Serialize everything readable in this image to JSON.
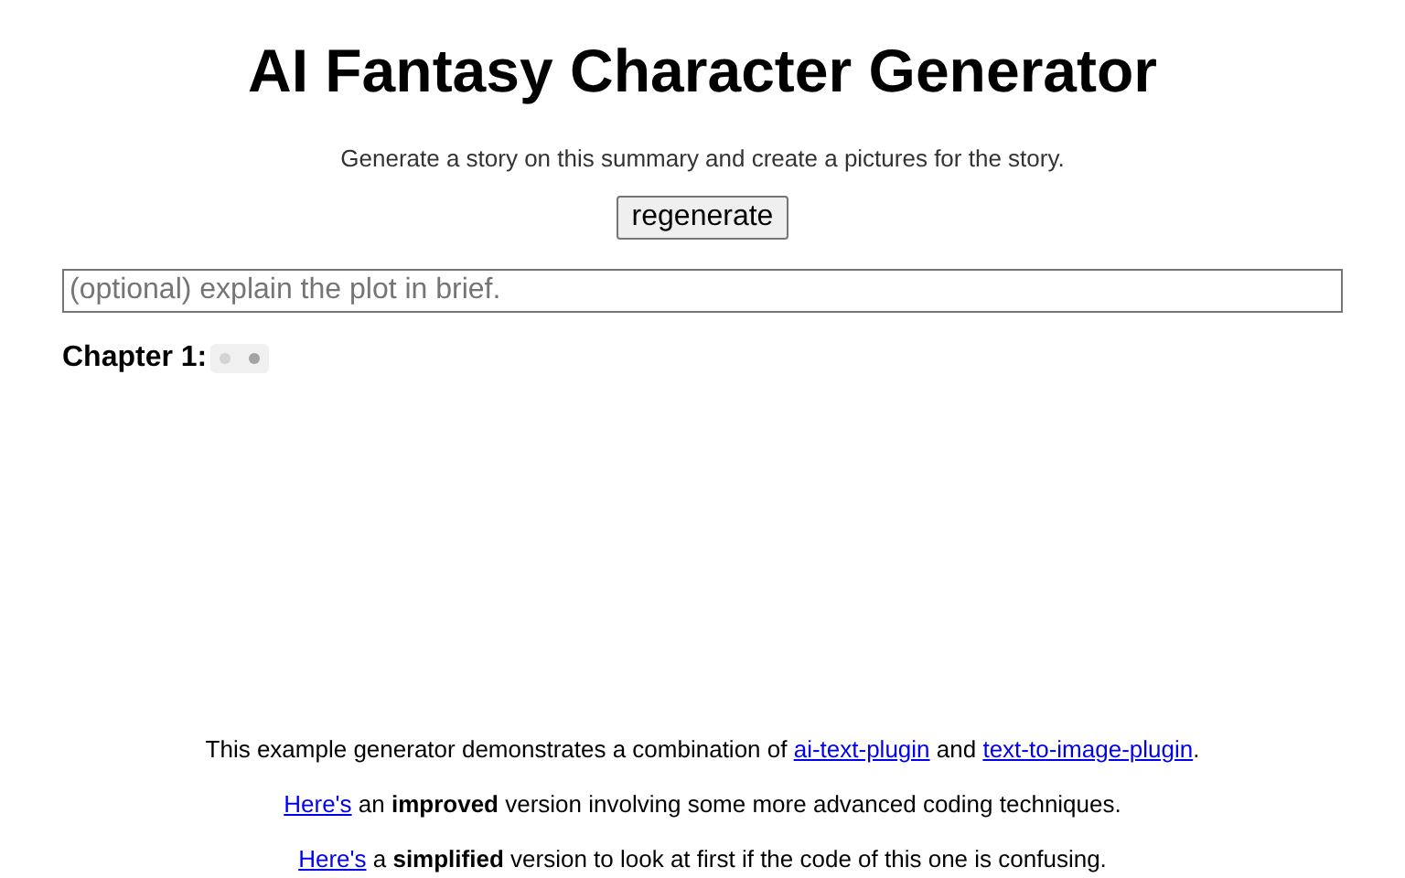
{
  "title": "AI Fantasy Character Generator",
  "subtitle": "Generate a story on this summary and create a pictures for the story.",
  "regenerate_button": "regenerate",
  "plot_field": {
    "placeholder": "(optional) explain the plot in brief."
  },
  "chapters": [
    {
      "label": "Chapter 1:",
      "loading": true
    }
  ],
  "footer": [
    [
      {
        "kind": "text",
        "text": "This example generator demonstrates a combination of "
      },
      {
        "kind": "link",
        "text": "ai-text-plugin"
      },
      {
        "kind": "text",
        "text": " and "
      },
      {
        "kind": "link",
        "text": "text-to-image-plugin"
      },
      {
        "kind": "text",
        "text": "."
      }
    ],
    [
      {
        "kind": "link",
        "text": "Here's"
      },
      {
        "kind": "text",
        "text": " an **improved** version involving some more advanced coding techniques."
      }
    ],
    [
      {
        "kind": "link",
        "text": "Here's"
      },
      {
        "kind": "text",
        "text": " a **simplified** version to look at first if the code of this one is confusing."
      }
    ]
  ]
}
